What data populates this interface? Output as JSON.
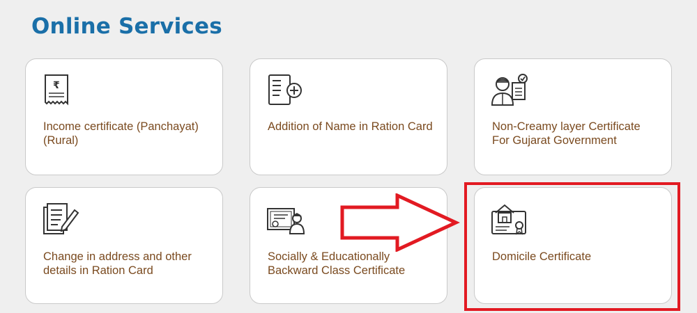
{
  "header": {
    "title": "Online Services"
  },
  "services": [
    {
      "label": "Income certificate (Panchayat) (Rural)",
      "icon": "rupee-receipt-icon"
    },
    {
      "label": "Addition of Name in Ration Card",
      "icon": "add-document-icon"
    },
    {
      "label": "Non-Creamy layer Certificate For Gujarat Government",
      "icon": "person-with-document-icon"
    },
    {
      "label": "Change in address and other details in Ration Card",
      "icon": "edit-document-icon"
    },
    {
      "label": "Socially & Educationally Backward Class Certificate",
      "icon": "certificate-person-icon"
    },
    {
      "label": "Domicile Certificate",
      "icon": "house-certificate-icon"
    }
  ],
  "annotation": {
    "highlight_color": "#e21a22",
    "points_to": "Domicile Certificate"
  }
}
